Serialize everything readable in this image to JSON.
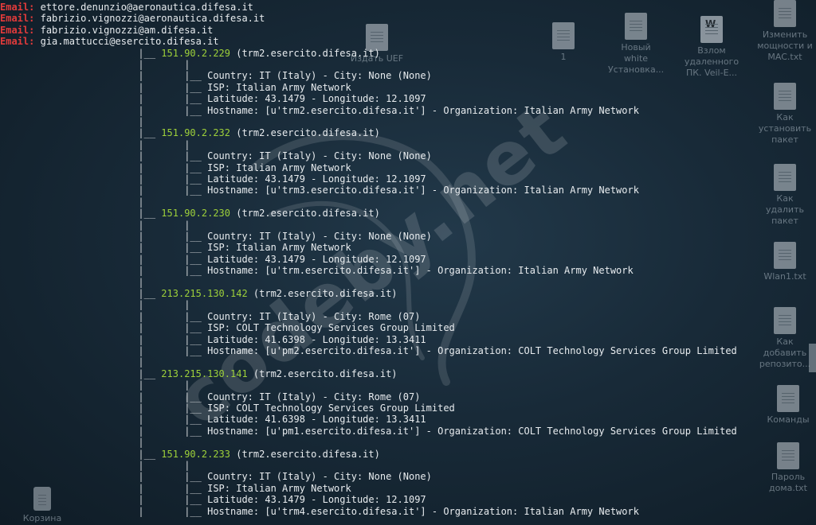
{
  "desktop_icons": [
    {
      "label": "Издать UEF",
      "x_note": "partially covered"
    },
    {
      "label": "1"
    },
    {
      "label": "Новый white Установка..."
    },
    {
      "label": "Взлом удаленного ПК. Veil-E..."
    },
    {
      "label": "Изменить мощности и MAC.txt"
    },
    {
      "label": "Как установить пакет"
    },
    {
      "label": "Как удалить пакет"
    },
    {
      "label": "Wlan1.txt"
    },
    {
      "label": "Как добавить репозито..."
    },
    {
      "label": "Команды"
    },
    {
      "label": "Пароль дома.txt"
    },
    {
      "label": "Корзина"
    }
  ],
  "watermark": "codeby.net",
  "emails": [
    {
      "label": "Email:",
      "value": "ettore.denunzio@aeronautica.difesa.it"
    },
    {
      "label": "Email:",
      "value": "fabrizio.vignozzi@aeronautica.difesa.it"
    },
    {
      "label": "Email:",
      "value": "fabrizio.vignozzi@am.difesa.it"
    },
    {
      "label": "Email:",
      "value": "gia.mattucci@esercito.difesa.it"
    }
  ],
  "hosts": [
    {
      "ip": "151.90.2.229",
      "name": "(trm2.esercito.difesa.it)",
      "country": "Country: IT (Italy) - City: None (None)",
      "isp": "ISP: Italian Army Network",
      "latlon": "Latitude: 43.1479 - Longitude: 12.1097",
      "hostname": "Hostname: [u'trm2.esercito.difesa.it'] - Organization: Italian Army Network"
    },
    {
      "ip": "151.90.2.232",
      "name": "(trm2.esercito.difesa.it)",
      "country": "Country: IT (Italy) - City: None (None)",
      "isp": "ISP: Italian Army Network",
      "latlon": "Latitude: 43.1479 - Longitude: 12.1097",
      "hostname": "Hostname: [u'trm3.esercito.difesa.it'] - Organization: Italian Army Network"
    },
    {
      "ip": "151.90.2.230",
      "name": "(trm2.esercito.difesa.it)",
      "country": "Country: IT (Italy) - City: None (None)",
      "isp": "ISP: Italian Army Network",
      "latlon": "Latitude: 43.1479 - Longitude: 12.1097",
      "hostname": "Hostname: [u'trm.esercito.difesa.it'] - Organization: Italian Army Network"
    },
    {
      "ip": "213.215.130.142",
      "name": "(trm2.esercito.difesa.it)",
      "country": "Country: IT (Italy) - City: Rome (07)",
      "isp": "ISP: COLT Technology Services Group Limited",
      "latlon": "Latitude: 41.6398 - Longitude: 13.3411",
      "hostname": "Hostname: [u'pm2.esercito.difesa.it'] - Organization: COLT Technology Services Group Limited"
    },
    {
      "ip": "213.215.130.141",
      "name": "(trm2.esercito.difesa.it)",
      "country": "Country: IT (Italy) - City: Rome (07)",
      "isp": "ISP: COLT Technology Services Group Limited",
      "latlon": "Latitude: 41.6398 - Longitude: 13.3411",
      "hostname": "Hostname: [u'pm1.esercito.difesa.it'] - Organization: COLT Technology Services Group Limited"
    },
    {
      "ip": "151.90.2.233",
      "name": "(trm2.esercito.difesa.it)",
      "country": "Country: IT (Italy) - City: None (None)",
      "isp": "ISP: Italian Army Network",
      "latlon": "Latitude: 43.1479 - Longitude: 12.1097",
      "hostname": "Hostname: [u'trm4.esercito.difesa.it'] - Organization: Italian Army Network"
    }
  ],
  "colors": {
    "label": "#e23b3b",
    "ip": "#9ed13a",
    "text": "#e8ecef"
  },
  "tree": {
    "branch": "|__ ",
    "pipe": "|",
    "sub": "|__ "
  }
}
